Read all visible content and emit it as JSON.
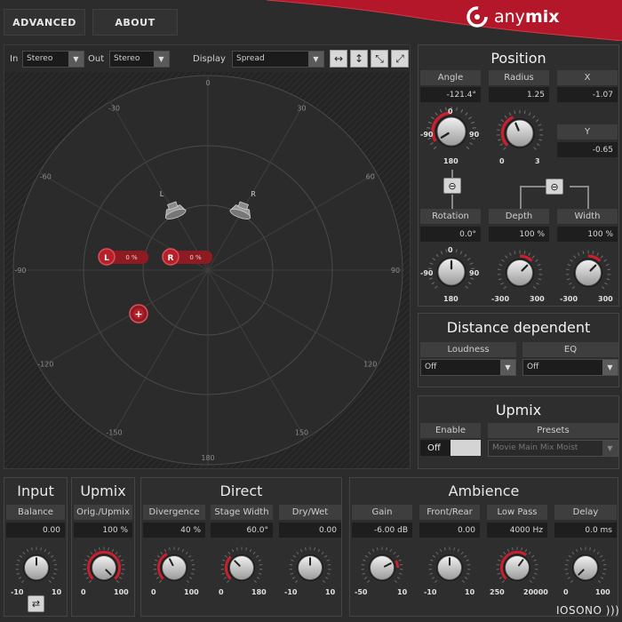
{
  "header": {
    "advanced_label": "ADVANCED",
    "about_label": "ABOUT",
    "brand_name": "anymix",
    "brand_name_light": "any",
    "brand_name_bold": "mix",
    "accent": "#b5172a"
  },
  "toolbar": {
    "in_label": "In",
    "in_value": "Stereo",
    "out_label": "Out",
    "out_value": "Stereo",
    "display_label": "Display",
    "display_value": "Spread",
    "tools": [
      "arrows-horizontal-icon",
      "arrows-vertical-icon",
      "arrows-diagonal-down-icon",
      "arrows-diagonal-up-icon"
    ]
  },
  "stage": {
    "angle_ticks": [
      "0",
      "30",
      "60",
      "90",
      "120",
      "150",
      "180",
      "-150",
      "-120",
      "-90",
      "-60",
      "-30"
    ],
    "speaker_left_label": "L",
    "speaker_right_label": "R",
    "source_left": {
      "label": "L",
      "value": "0 %"
    },
    "source_right": {
      "label": "R",
      "value": "0 %"
    },
    "center_marker": "+"
  },
  "position": {
    "title": "Position",
    "angle": {
      "label": "Angle",
      "value": "-121.4°",
      "min": "-90",
      "max": "90",
      "top": "0",
      "bottom": "180"
    },
    "radius": {
      "label": "Radius",
      "value": "1.25",
      "min": "0",
      "max": "3"
    },
    "x": {
      "label": "X",
      "value": "-1.07"
    },
    "y": {
      "label": "Y",
      "value": "-0.65"
    },
    "rotation": {
      "label": "Rotation",
      "value": "0.0°",
      "min": "-90",
      "max": "90",
      "top": "0",
      "bottom": "180"
    },
    "depth": {
      "label": "Depth",
      "value": "100 %",
      "min": "-300",
      "max": "300"
    },
    "width": {
      "label": "Width",
      "value": "100 %",
      "min": "-300",
      "max": "300"
    }
  },
  "distance": {
    "title": "Distance dependent",
    "loudness": {
      "label": "Loudness",
      "value": "Off"
    },
    "eq": {
      "label": "EQ",
      "value": "Off"
    }
  },
  "upmix_panel": {
    "title": "Upmix",
    "enable_label": "Enable",
    "enable_value": "Off",
    "presets_label": "Presets",
    "presets_value": "Movie Main Mix Moist"
  },
  "bottom": {
    "input": {
      "title": "Input",
      "balance": {
        "label": "Balance",
        "value": "0.00",
        "min": "-10",
        "max": "10"
      }
    },
    "upmix": {
      "title": "Upmix",
      "orig": {
        "label": "Orig./Upmix",
        "value": "100 %",
        "min": "0",
        "max": "100"
      }
    },
    "direct": {
      "title": "Direct",
      "divergence": {
        "label": "Divergence",
        "value": "40 %",
        "min": "0",
        "max": "100"
      },
      "stage_width": {
        "label": "Stage Width",
        "value": "60.0°",
        "min": "0",
        "max": "180"
      },
      "dry_wet": {
        "label": "Dry/Wet",
        "value": "0.00",
        "min": "-10",
        "max": "10"
      }
    },
    "ambience": {
      "title": "Ambience",
      "gain": {
        "label": "Gain",
        "value": "-6.00 dB",
        "min": "-50",
        "max": "10"
      },
      "front_rear": {
        "label": "Front/Rear",
        "value": "0.00",
        "min": "-10",
        "max": "10"
      },
      "low_pass": {
        "label": "Low Pass",
        "value": "4000 Hz",
        "min": "250",
        "max": "20000"
      },
      "delay": {
        "label": "Delay",
        "value": "0.0 ms",
        "min": "0",
        "max": "100"
      }
    }
  },
  "footer": {
    "brand": "IOSONO )))"
  }
}
